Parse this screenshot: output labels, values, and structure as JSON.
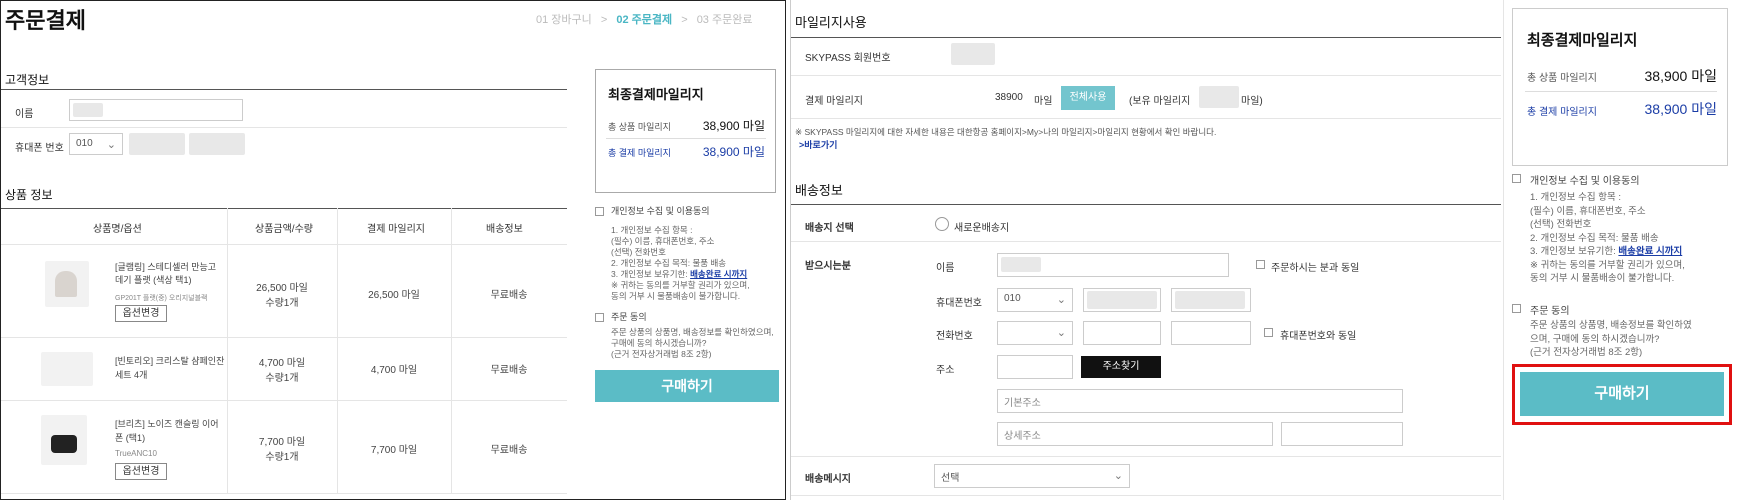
{
  "panel1": {
    "page_title": "주문결제",
    "steps": [
      {
        "label": "01 장바구니",
        "active": false
      },
      {
        "label": "02 주문결제",
        "active": true
      },
      {
        "label": "03 주문완료",
        "active": false
      }
    ],
    "step_sep": ">",
    "customer": {
      "section_title": "고객정보",
      "name_label": "이름",
      "phone_label": "휴대폰 번호",
      "phone_prefix": "010"
    },
    "products": {
      "section_title": "상품 정보",
      "headers": [
        "상품명/옵션",
        "상품금액/수량",
        "결제 마일리지",
        "배송정보"
      ],
      "rows": [
        {
          "name": "[글램링] 스테디셀러 만능고데기 플랫 (색상 택1)",
          "option": "GP201T 플랫(중) 오리지널블랙",
          "price": "26,500 마일",
          "qty": "수량1개",
          "mileage": "26,500 마일",
          "shipping": "무료배송",
          "option_button": "옵션변경"
        },
        {
          "name": "[빈토리오] 크리스탈 샴페인잔 세트 4개",
          "option": "",
          "price": "4,700 마일",
          "qty": "수량1개",
          "mileage": "4,700 마일",
          "shipping": "무료배송",
          "option_button": ""
        },
        {
          "name": "[브리츠] 노이즈 캔슬링 이어폰 (택1)",
          "option": "TrueANC10",
          "price": "7,700 마일",
          "qty": "수량1개",
          "mileage": "7,700 마일",
          "shipping": "무료배송",
          "option_button": "옵션변경"
        }
      ]
    },
    "summary": {
      "title": "최종결제마일리지",
      "total_label": "총 상품 마일리지",
      "total_value": "38,900 마일",
      "pay_label": "총 결제 마일리지",
      "pay_value": "38,900 마일"
    },
    "consent1": {
      "label": "개인정보 수집 및 이용동의",
      "lines": [
        "1. 개인정보 수집 항목 :",
        "(필수) 이름, 휴대폰번호, 주소",
        "(선택) 전화번호",
        "2. 개인정보 수집 목적: 물품 배송",
        "3. 개인정보 보유기한: "
      ],
      "link": "배송완료 시까지",
      "note": [
        "※ 귀하는 동의를 거부할 권리가 있으며,",
        "동의 거부 시 물품배송이 불가합니다."
      ]
    },
    "consent2": {
      "label": "주문 동의",
      "lines": [
        "주문 상품의 상품명, 배송정보를 확인하였으며, 구매에 동의 하시겠습니까?",
        "(근거 전자상거래법 8조 2항)"
      ]
    },
    "buy_button": "구매하기"
  },
  "panel2": {
    "mileage_section": "마일리지사용",
    "skypass_label": "SKYPASS 회원번호",
    "pay_mileage_label": "결제 마일리지",
    "pay_mileage_value": "38900",
    "pay_mileage_unit": "마일",
    "use_all_button": "전체사용",
    "owned_prefix": "(보유 마일리지",
    "owned_suffix": "마일)",
    "notice": "※ SKYPASS 마일리지에 대한 자세한 내용은 대한항공 홈페이지>My>나의 마일리지>마일리지 현황에서 확인 바랍니다.",
    "notice_link": ">바로가기",
    "shipping_section": "배송정보",
    "dest_label": "배송지 선택",
    "dest_option": "새로운배송지",
    "receiver_label": "받으시는분",
    "name_label": "이름",
    "same_as_orderer": "주문하시는 분과 동일",
    "mobile_label": "휴대폰번호",
    "mobile_prefix": "010",
    "phone_label": "전화번호",
    "same_as_mobile": "휴대폰번호와 동일",
    "address_label": "주소",
    "find_address_button": "주소찾기",
    "base_address_placeholder": "기본주소",
    "detail_address_placeholder": "상세주소",
    "message_label": "배송메시지",
    "message_select": "선택"
  },
  "panel3": {
    "summary": {
      "title": "최종결제마일리지",
      "total_label": "총 상품 마일리지",
      "total_value": "38,900 마일",
      "pay_label": "총 결제 마일리지",
      "pay_value": "38,900 마일"
    },
    "consent1": {
      "label": "개인정보 수집 및 이용동의",
      "lines": [
        "1. 개인정보 수집 항목 :",
        "(필수) 이름, 휴대폰번호, 주소",
        "(선택) 전화번호",
        "2. 개인정보 수집 목적: 물품 배송",
        "3. 개인정보 보유기한: "
      ],
      "link": "배송완료 시까지",
      "note": [
        "※ 귀하는 동의를 거부할 권리가 있으며,",
        "동의 거부 시 물품배송이 불가합니다."
      ]
    },
    "consent2": {
      "label": "주문 동의",
      "lines": [
        "주문 상품의 상품명, 배송정보를 확인하였",
        "으며, 구매에 동의 하시겠습니까?",
        "(근거 전자상거래법 8조 2항)"
      ]
    },
    "buy_button": "구매하기"
  },
  "colors": {
    "accent_teal": "#5bbcc6",
    "step_active": "#4ab6c4",
    "pay_blue": "#1b3da6",
    "highlight_red": "#e01010"
  }
}
